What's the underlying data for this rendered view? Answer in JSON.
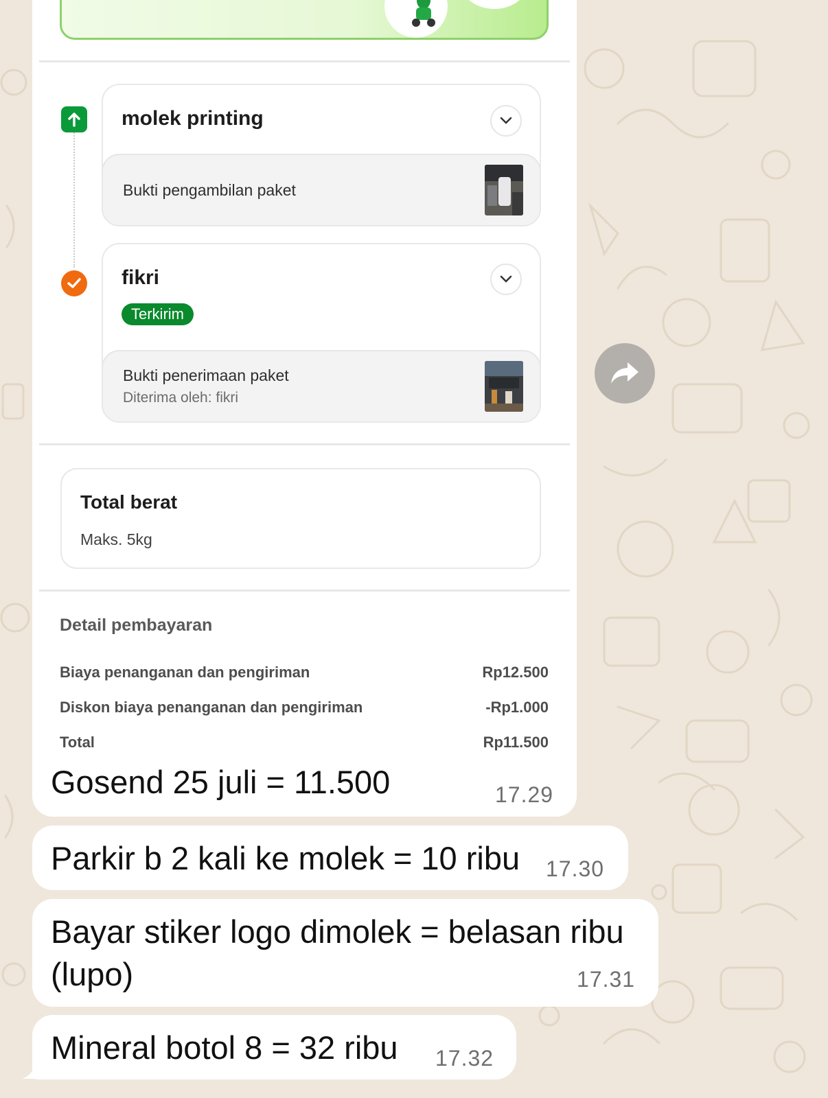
{
  "stops": [
    {
      "name": "molek printing",
      "proof_title": "Bukti pengambilan paket",
      "proof_sub": ""
    },
    {
      "name": "fikri",
      "status": "Terkirim",
      "proof_title": "Bukti penerimaan paket",
      "proof_sub": "Diterima oleh: fikri"
    }
  ],
  "weight": {
    "title": "Total berat",
    "value": "Maks. 5kg"
  },
  "payment": {
    "heading": "Detail pembayaran",
    "rows": [
      {
        "label": "Biaya penanganan dan pengiriman",
        "value": "Rp12.500"
      },
      {
        "label": "Diskon biaya penanganan dan pengiriman",
        "value": "-Rp1.000"
      },
      {
        "label": "Total",
        "value": "Rp11.500"
      }
    ]
  },
  "messages": [
    {
      "text": "Gosend 25 juli = 11.500",
      "time": "17.29"
    },
    {
      "text": "Parkir b 2 kali ke molek = 10 ribu",
      "time": "17.30"
    },
    {
      "text_line1": "Bayar stiker logo dimolek = belasan ribu",
      "text_line2": "(lupo)",
      "time": "17.31"
    },
    {
      "text": "Mineral botol 8 = 32 ribu",
      "time": "17.32"
    }
  ],
  "icons": {
    "pickup": "arrow-up-icon",
    "delivered": "check-icon",
    "expand": "chevron-down-icon",
    "forward": "forward-icon"
  },
  "colors": {
    "brand_green": "#0a8a2c",
    "delivered_orange": "#f06a10",
    "chat_background": "#efe7dc",
    "bubble": "#ffffff"
  }
}
